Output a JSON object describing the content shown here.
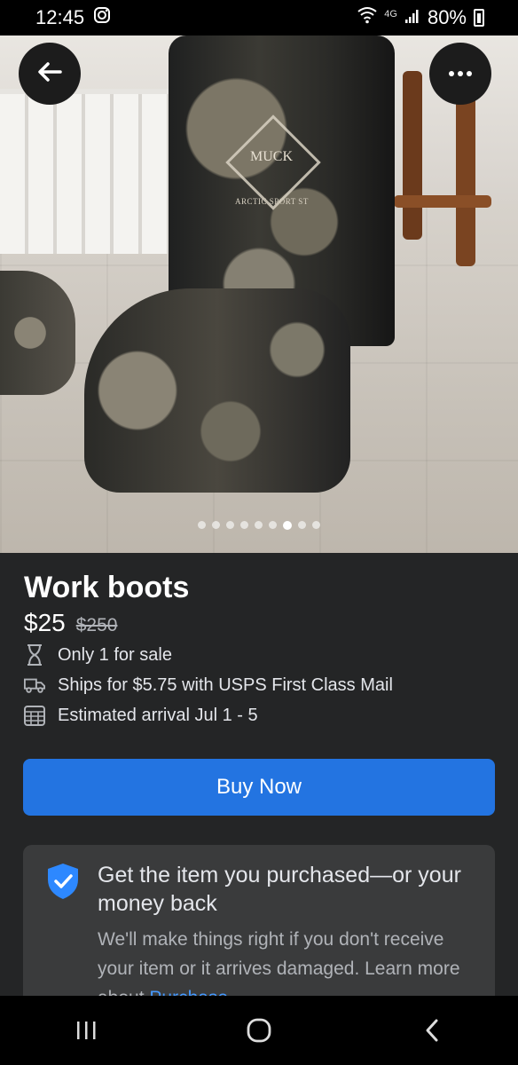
{
  "status_bar": {
    "time": "12:45",
    "network": "4G",
    "battery": "80%"
  },
  "hero": {
    "photo_logo_text": "MUCK",
    "photo_model_text": "ARCTIC SPORT ST",
    "page_count": 9,
    "active_page": 7
  },
  "listing": {
    "title": "Work boots",
    "price": "$25",
    "original_price": "$250",
    "details": [
      {
        "icon": "hourglass-icon",
        "text": "Only 1 for sale"
      },
      {
        "icon": "truck-icon",
        "text": "Ships for $5.75 with USPS First Class Mail"
      },
      {
        "icon": "calendar-icon",
        "text": "Estimated arrival Jul 1 - 5"
      }
    ],
    "buy_label": "Buy Now"
  },
  "protection": {
    "title": "Get the item you purchased—or your money back",
    "body": "We'll make things right if you don't receive your item or it arrives damaged. Learn more about ",
    "link": "Purchase"
  },
  "colors": {
    "background": "#242526",
    "primary_button": "#2374e1",
    "card": "#3a3b3c",
    "link": "#4599ff",
    "shield": "#2d88ff"
  }
}
